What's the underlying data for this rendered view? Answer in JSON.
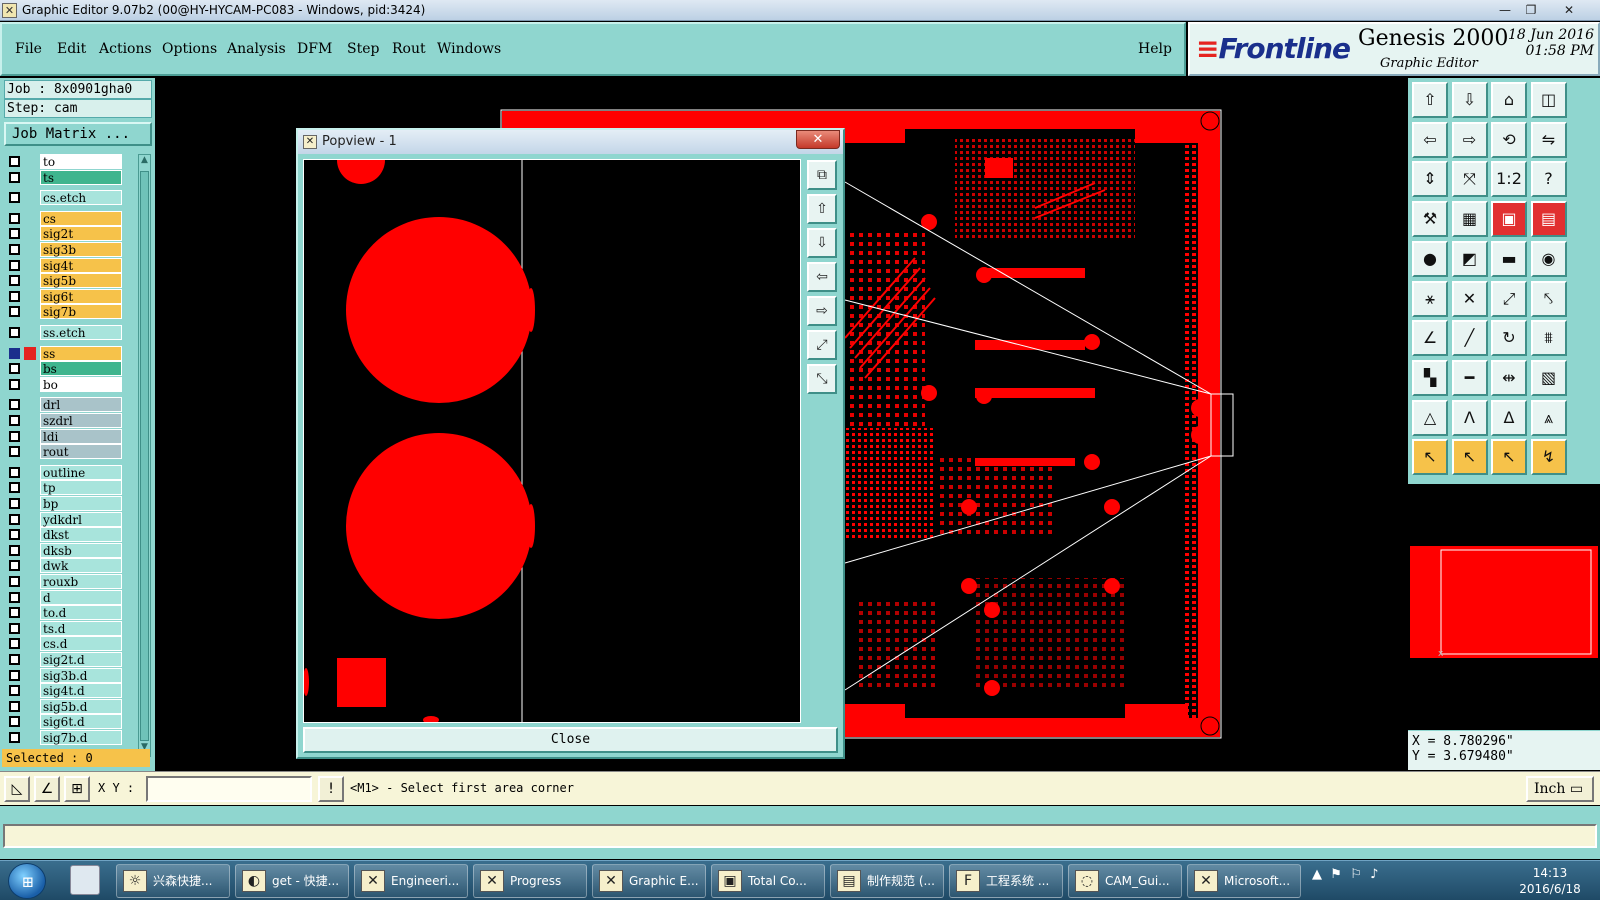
{
  "window": {
    "title": "Graphic Editor 9.07b2 (00@HY-HYCAM-PC083 - Windows, pid:3424)",
    "app_icon": "x-icon"
  },
  "menu": [
    "File",
    "Edit",
    "Actions",
    "Options",
    "Analysis",
    "DFM",
    "Step",
    "Rout",
    "Windows"
  ],
  "help_label": "Help",
  "brand": {
    "logo": "Frontline",
    "product": "Genesis 2000",
    "subtitle": "Graphic Editor",
    "date": "18 Jun 2016",
    "time": "01:58 PM"
  },
  "job": {
    "job_line": "Job : 8x0901gha0",
    "step_line": "Step: cam",
    "matrix_button": "Job Matrix ..."
  },
  "layers": [
    {
      "name": "to",
      "color": "#ffffff",
      "checked": false
    },
    {
      "name": "ts",
      "color": "#3fb58e",
      "checked": false
    },
    {
      "name": "cs.etch",
      "color": "#a8e4dc",
      "checked": false
    },
    {
      "name": "cs",
      "color": "#f6c24a",
      "checked": false
    },
    {
      "name": "sig2t",
      "color": "#f6c24a",
      "checked": false
    },
    {
      "name": "sig3b",
      "color": "#f6c24a",
      "checked": false
    },
    {
      "name": "sig4t",
      "color": "#f6c24a",
      "checked": false
    },
    {
      "name": "sig5b",
      "color": "#f6c24a",
      "checked": false
    },
    {
      "name": "sig6t",
      "color": "#f6c24a",
      "checked": false
    },
    {
      "name": "sig7b",
      "color": "#f6c24a",
      "checked": false
    },
    {
      "name": "ss.etch",
      "color": "#a8e4dc",
      "checked": false
    },
    {
      "name": "ss",
      "color": "#f6c24a",
      "checked": true
    },
    {
      "name": "bs",
      "color": "#3fb58e",
      "checked": false
    },
    {
      "name": "bo",
      "color": "#ffffff",
      "checked": false
    },
    {
      "name": "drl",
      "color": "#a9c3c9",
      "checked": false
    },
    {
      "name": "szdrl",
      "color": "#a9c3c9",
      "checked": false
    },
    {
      "name": "ldi",
      "color": "#a9c3c9",
      "checked": false
    },
    {
      "name": "rout",
      "color": "#a9c3c9",
      "checked": false
    },
    {
      "name": "outline",
      "color": "#a8e4dc",
      "checked": false
    },
    {
      "name": "tp",
      "color": "#a8e4dc",
      "checked": false
    },
    {
      "name": "bp",
      "color": "#a8e4dc",
      "checked": false
    },
    {
      "name": "ydkdrl",
      "color": "#a8e4dc",
      "checked": false
    },
    {
      "name": "dkst",
      "color": "#a8e4dc",
      "checked": false
    },
    {
      "name": "dksb",
      "color": "#a8e4dc",
      "checked": false
    },
    {
      "name": "dwk",
      "color": "#a8e4dc",
      "checked": false
    },
    {
      "name": "rouxb",
      "color": "#a8e4dc",
      "checked": false
    },
    {
      "name": "d",
      "color": "#a8e4dc",
      "checked": false
    },
    {
      "name": "to.d",
      "color": "#a8e4dc",
      "checked": false
    },
    {
      "name": "ts.d",
      "color": "#a8e4dc",
      "checked": false
    },
    {
      "name": "cs.d",
      "color": "#a8e4dc",
      "checked": false
    },
    {
      "name": "sig2t.d",
      "color": "#a8e4dc",
      "checked": false
    },
    {
      "name": "sig3b.d",
      "color": "#a8e4dc",
      "checked": false
    },
    {
      "name": "sig4t.d",
      "color": "#a8e4dc",
      "checked": false
    },
    {
      "name": "sig5b.d",
      "color": "#a8e4dc",
      "checked": false
    },
    {
      "name": "sig6t.d",
      "color": "#a8e4dc",
      "checked": false
    },
    {
      "name": "sig7b.d",
      "color": "#a8e4dc",
      "checked": false
    }
  ],
  "selected_label": "Selected : 0",
  "popview": {
    "title": "Popview - 1",
    "close_label": "Close"
  },
  "coords": {
    "x": "X = 8.780296\"",
    "y": "Y = 3.679480\""
  },
  "status": {
    "xy_label": "X Y :",
    "prompt": "<M1> - Select first area corner",
    "units": "Inch"
  },
  "taskbar": {
    "tasks": [
      "兴森快捷...",
      "get - 快捷...",
      "Engineeri...",
      "Progress",
      "Graphic E...",
      "Total Co...",
      "制作规范 (...",
      "工程系统 ...",
      "CAM_Gui...",
      "Microsoft..."
    ],
    "time": "14:13",
    "date": "2016/6/18"
  },
  "colors": {
    "panel": "#8fd6cf",
    "copper": "#ff0000",
    "highlight": "#f6c24a"
  }
}
